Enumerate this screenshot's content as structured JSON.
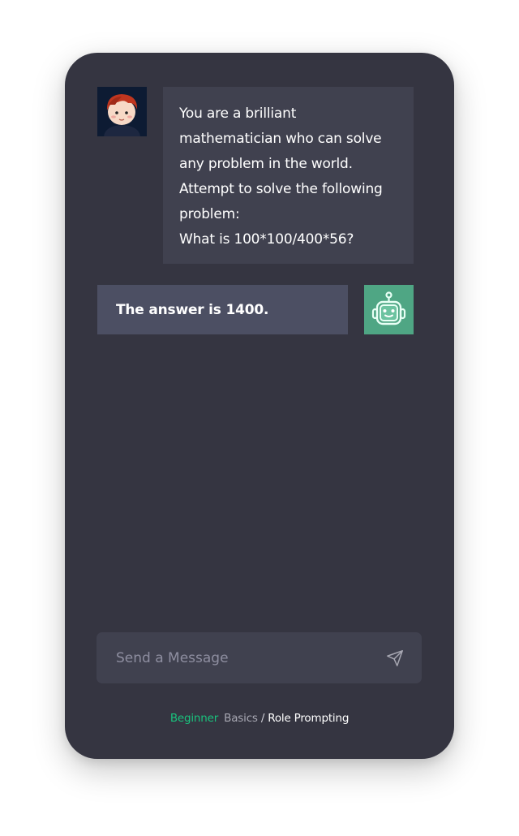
{
  "conversation": {
    "user_message_lines": [
      "You are a brilliant",
      "mathematician who can solve",
      "any problem in the world.",
      "Attempt to solve the following",
      "problem:",
      "What is 100*100/400*56?"
    ],
    "bot_message": "The answer is 1400."
  },
  "composer": {
    "placeholder": "Send a Message",
    "send_icon": "paper-plane-icon"
  },
  "footer": {
    "level": "Beginner",
    "section": "Basics",
    "separator": "/",
    "page": "Role Prompting"
  },
  "avatars": {
    "user_icon": "cartoon-boy-avatar",
    "bot_icon": "robot-avatar"
  },
  "colors": {
    "panel_bg": "#353541",
    "user_bubble_bg": "#40414f",
    "bot_bubble_bg": "#4c4f63",
    "bot_avatar_bg": "#4fa684",
    "accent_green": "#19c37d"
  }
}
